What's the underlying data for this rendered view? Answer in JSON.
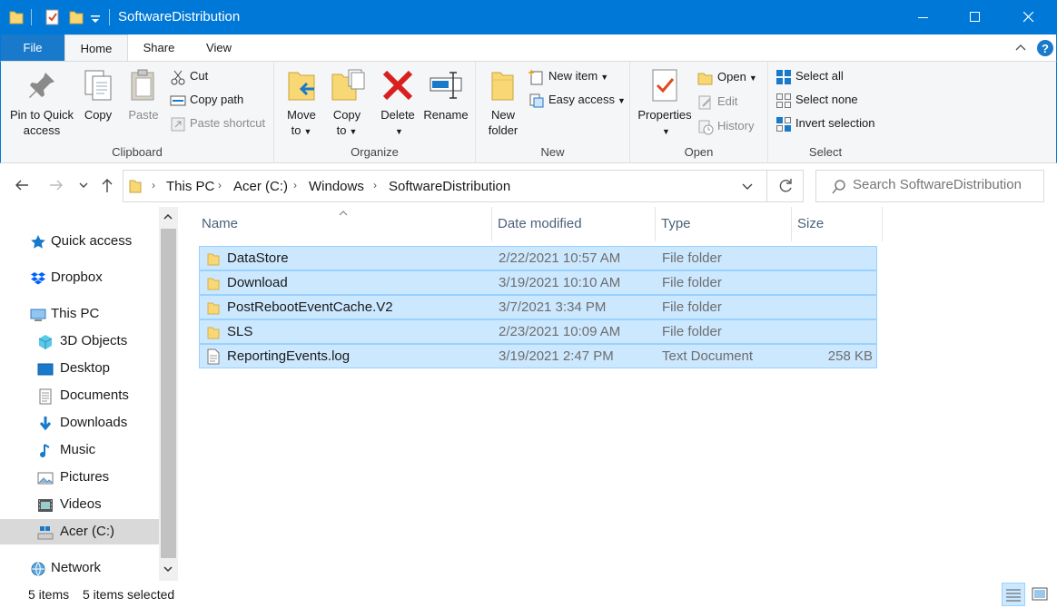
{
  "window": {
    "title": "SoftwareDistribution"
  },
  "ribbon_tabs": [
    {
      "label": "File"
    },
    {
      "label": "Home"
    },
    {
      "label": "Share"
    },
    {
      "label": "View"
    }
  ],
  "ribbon": {
    "clipboard": {
      "label": "Clipboard",
      "pin_label": "Pin to Quick access",
      "pin_line1": "Pin to Quick",
      "pin_line2": "access",
      "copy_label": "Copy",
      "paste_label": "Paste",
      "cut_label": "Cut",
      "copy_path_label": "Copy path",
      "paste_shortcut_label": "Paste shortcut"
    },
    "organize": {
      "label": "Organize",
      "move_to_line1": "Move",
      "move_to_line2": "to",
      "copy_to_line1": "Copy",
      "copy_to_line2": "to",
      "delete_label": "Delete",
      "rename_label": "Rename"
    },
    "new": {
      "label": "New",
      "new_folder_line1": "New",
      "new_folder_line2": "folder",
      "new_item_label": "New item",
      "easy_access_label": "Easy access"
    },
    "open": {
      "label": "Open",
      "properties_label": "Properties",
      "open_label": "Open",
      "edit_label": "Edit",
      "history_label": "History"
    },
    "select": {
      "label": "Select",
      "select_all_label": "Select all",
      "select_none_label": "Select none",
      "invert_selection_label": "Invert selection"
    }
  },
  "breadcrumb": [
    "This PC",
    "Acer (C:)",
    "Windows",
    "SoftwareDistribution"
  ],
  "search": {
    "placeholder": "Search SoftwareDistribution"
  },
  "nav_pane": {
    "items": [
      {
        "label": "Quick access",
        "icon": "star-icon"
      },
      {
        "label": "Dropbox",
        "icon": "dropbox-icon"
      },
      {
        "label": "This PC",
        "icon": "computer-icon"
      },
      {
        "label": "3D Objects",
        "icon": "cube-icon"
      },
      {
        "label": "Desktop",
        "icon": "desktop-icon"
      },
      {
        "label": "Documents",
        "icon": "document-icon"
      },
      {
        "label": "Downloads",
        "icon": "download-icon"
      },
      {
        "label": "Music",
        "icon": "music-icon"
      },
      {
        "label": "Pictures",
        "icon": "picture-icon"
      },
      {
        "label": "Videos",
        "icon": "video-icon"
      },
      {
        "label": "Acer (C:)",
        "icon": "drive-icon",
        "selected": true
      },
      {
        "label": "Network",
        "icon": "network-icon"
      }
    ]
  },
  "file_list": {
    "columns": [
      "Name",
      "Date modified",
      "Type",
      "Size"
    ],
    "rows": [
      {
        "name": "DataStore",
        "date": "2/22/2021 10:57 AM",
        "type": "File folder",
        "size": "",
        "icon": "folder-icon"
      },
      {
        "name": "Download",
        "date": "3/19/2021 10:10 AM",
        "type": "File folder",
        "size": "",
        "icon": "folder-icon"
      },
      {
        "name": "PostRebootEventCache.V2",
        "date": "3/7/2021 3:34 PM",
        "type": "File folder",
        "size": "",
        "icon": "folder-icon"
      },
      {
        "name": "SLS",
        "date": "2/23/2021 10:09 AM",
        "type": "File folder",
        "size": "",
        "icon": "folder-icon"
      },
      {
        "name": "ReportingEvents.log",
        "date": "3/19/2021 2:47 PM",
        "type": "Text Document",
        "size": "258 KB",
        "icon": "text-file-icon"
      }
    ]
  },
  "status": {
    "item_count": "5 items",
    "selected_count": "5 items selected"
  },
  "colors": {
    "accent": "#0078d7",
    "selection": "#cce8ff",
    "selection_border": "#99d1ff",
    "folder": "#f8d775"
  }
}
